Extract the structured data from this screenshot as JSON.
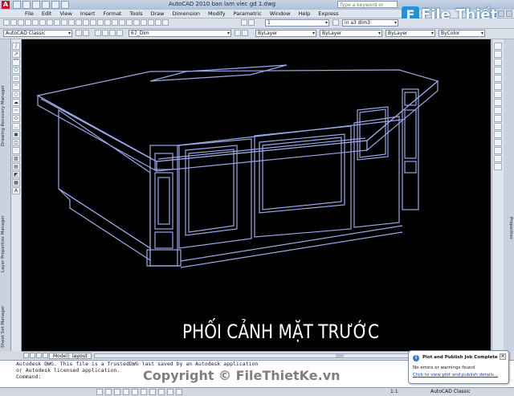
{
  "app": {
    "logo_letter": "A",
    "title": "AutoCAD 2010     ban lam viec gd 1.dwg",
    "search_placeholder": "Type a keyword or phrase",
    "brand_name": "File Thiết Kế.vn"
  },
  "menu": {
    "items": [
      "File",
      "Edit",
      "View",
      "Insert",
      "Format",
      "Tools",
      "Draw",
      "Dimension",
      "Modify",
      "Parametric",
      "Window",
      "Help",
      "Express"
    ]
  },
  "toolbar1": {
    "layer_value": "1",
    "dimstyle_value": "in a3 dim3"
  },
  "toolbar2": {
    "workspace": "AutoCAD Classic",
    "layer": "67_Dim",
    "color": "ByLayer",
    "linetype": "ByLayer",
    "lineweight": "ByLayer",
    "plotstyle": "ByColor"
  },
  "left_palettes": [
    "Drawing Recovery Manager",
    "Layer Properties Manager",
    "Sheet Set Manager"
  ],
  "right_palettes": [
    "Properties"
  ],
  "drawing": {
    "caption": "PHỐI CẢNH MẶT TRƯỚC",
    "line_color": "#9aa8e8",
    "bg_color": "#000000"
  },
  "layout_tabs": [
    "Model",
    "layout"
  ],
  "command": {
    "lines": [
      "Autodesk DWG.  This file is a TrustedDWG last saved by an Autodesk application",
      "or Autodesk licensed application.",
      "Command:"
    ]
  },
  "watermark": "Copyright © FileThietKe.vn",
  "status": {
    "scale": "1:1",
    "workspace": "AutoCAD Classic"
  },
  "balloon": {
    "title": "Plot and Publish Job Complete",
    "message": "No errors or warnings found",
    "link": "Click to view plot and publish details..."
  }
}
